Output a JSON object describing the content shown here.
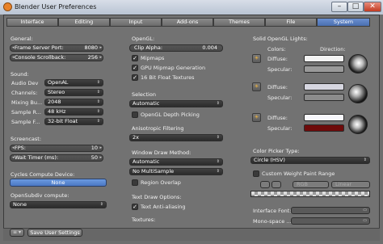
{
  "window": {
    "title": "Blender User Preferences",
    "min": "–",
    "max": "□",
    "close": "✕"
  },
  "tabs": [
    {
      "label": "Interface"
    },
    {
      "label": "Editing"
    },
    {
      "label": "Input"
    },
    {
      "label": "Add-ons"
    },
    {
      "label": "Themes"
    },
    {
      "label": "File"
    },
    {
      "label": "System"
    }
  ],
  "active_tab": "System",
  "general": {
    "header": "General:",
    "frame_server_port": {
      "label": "Frame Server Port:",
      "value": "8080"
    },
    "console_scrollback": {
      "label": "Console Scrollback:",
      "value": "256"
    }
  },
  "sound": {
    "header": "Sound:",
    "audio_dev": {
      "label": "Audio Dev",
      "value": "OpenAL"
    },
    "channels": {
      "label": "Channels:",
      "value": "Stereo"
    },
    "mixing_buffer": {
      "label": "Mixing Bu...",
      "value": "2048"
    },
    "sample_rate": {
      "label": "Sample R...",
      "value": "48 kHz"
    },
    "sample_format": {
      "label": "Sample F...",
      "value": "32-bit Float"
    }
  },
  "screencast": {
    "header": "Screencast:",
    "fps": {
      "label": "FPS:",
      "value": "10"
    },
    "wait_timer": {
      "label": "Wait Timer (ms):",
      "value": "50"
    }
  },
  "cycles": {
    "header": "Cycles Compute Device:",
    "value": "None"
  },
  "opensubdiv": {
    "header": "OpenSubdiv compute:",
    "value": "None"
  },
  "opengl": {
    "header": "OpenGL:",
    "clip_alpha": {
      "label": "Clip Alpha:",
      "value": "0.004"
    },
    "mipmaps": "Mipmaps",
    "gpu_mipmap": "GPU Mipmap Generation",
    "float_textures": "16 Bit Float Textures"
  },
  "selection": {
    "header": "Selection",
    "value": "Automatic",
    "depth_picking": "OpenGL Depth Picking"
  },
  "anisotropic": {
    "header": "Anisotropic Filtering",
    "value": "2x"
  },
  "window_draw": {
    "header": "Window Draw Method:",
    "value": "Automatic",
    "multisample": "No MultiSample",
    "region_overlap": "Region Overlap"
  },
  "text_draw": {
    "header": "Text Draw Options:",
    "antialiasing": "Text Anti-aliasing"
  },
  "textures": {
    "header": "Textures:"
  },
  "solid_lights": {
    "header": "Solid OpenGL Lights:",
    "colors_label": "Colors:",
    "direction_label": "Direction:",
    "diffuse_label": "Diffuse:",
    "specular_label": "Specular:",
    "lights": [
      {
        "diffuse": "#f2f2f2",
        "specular": "#9a9a9a"
      },
      {
        "diffuse": "#d6d6e0",
        "specular": "#8c8c8c"
      },
      {
        "diffuse": "#f6f6fb",
        "specular": "#6e0a0a"
      }
    ]
  },
  "color_picker": {
    "header": "Color Picker Type:",
    "value": "Circle (HSV)"
  },
  "weight_paint": {
    "label": "Custom Weight Paint Range",
    "rgb": "RGB",
    "linear": "Linear"
  },
  "interface_font": {
    "label": "Interface Font:"
  },
  "mono_font": {
    "label": "Mono-space ..."
  },
  "footer": {
    "save": "Save User Settings",
    "menu": "≡ ▾"
  },
  "colors": {
    "accent": "#5a86d0",
    "panel": "#727272",
    "field": "#2f2f2f"
  },
  "icons": {
    "bulb": "light-bulb-icon",
    "check": "checkmark-icon"
  }
}
